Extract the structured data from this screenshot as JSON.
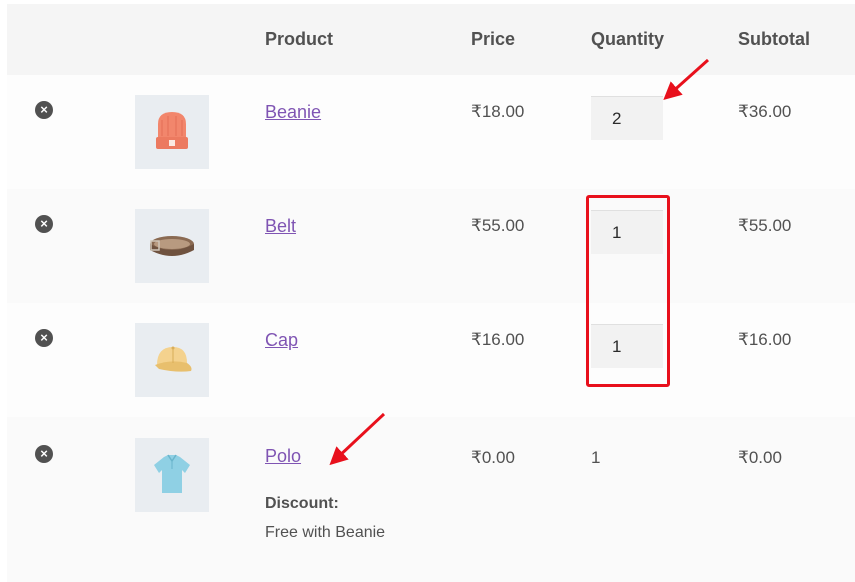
{
  "cart": {
    "headers": {
      "product": "Product",
      "price": "Price",
      "quantity": "Quantity",
      "subtotal": "Subtotal"
    },
    "remove_symbol": "×",
    "items": [
      {
        "name": "Beanie",
        "price": "₹18.00",
        "quantity": "2",
        "subtotal": "₹36.00",
        "image_icon": "beanie-icon"
      },
      {
        "name": "Belt",
        "price": "₹55.00",
        "quantity": "1",
        "subtotal": "₹55.00",
        "image_icon": "belt-icon"
      },
      {
        "name": "Cap",
        "price": "₹16.00",
        "quantity": "1",
        "subtotal": "₹16.00",
        "image_icon": "cap-icon"
      },
      {
        "name": "Polo",
        "price": "₹0.00",
        "quantity": "1",
        "subtotal": "₹0.00",
        "image_icon": "polo-icon",
        "meta_key": "Discount:",
        "meta_value": "Free with Beanie"
      }
    ]
  },
  "colors": {
    "link": "#7f54b3",
    "annotation": "#e8101c",
    "text": "#515151"
  }
}
